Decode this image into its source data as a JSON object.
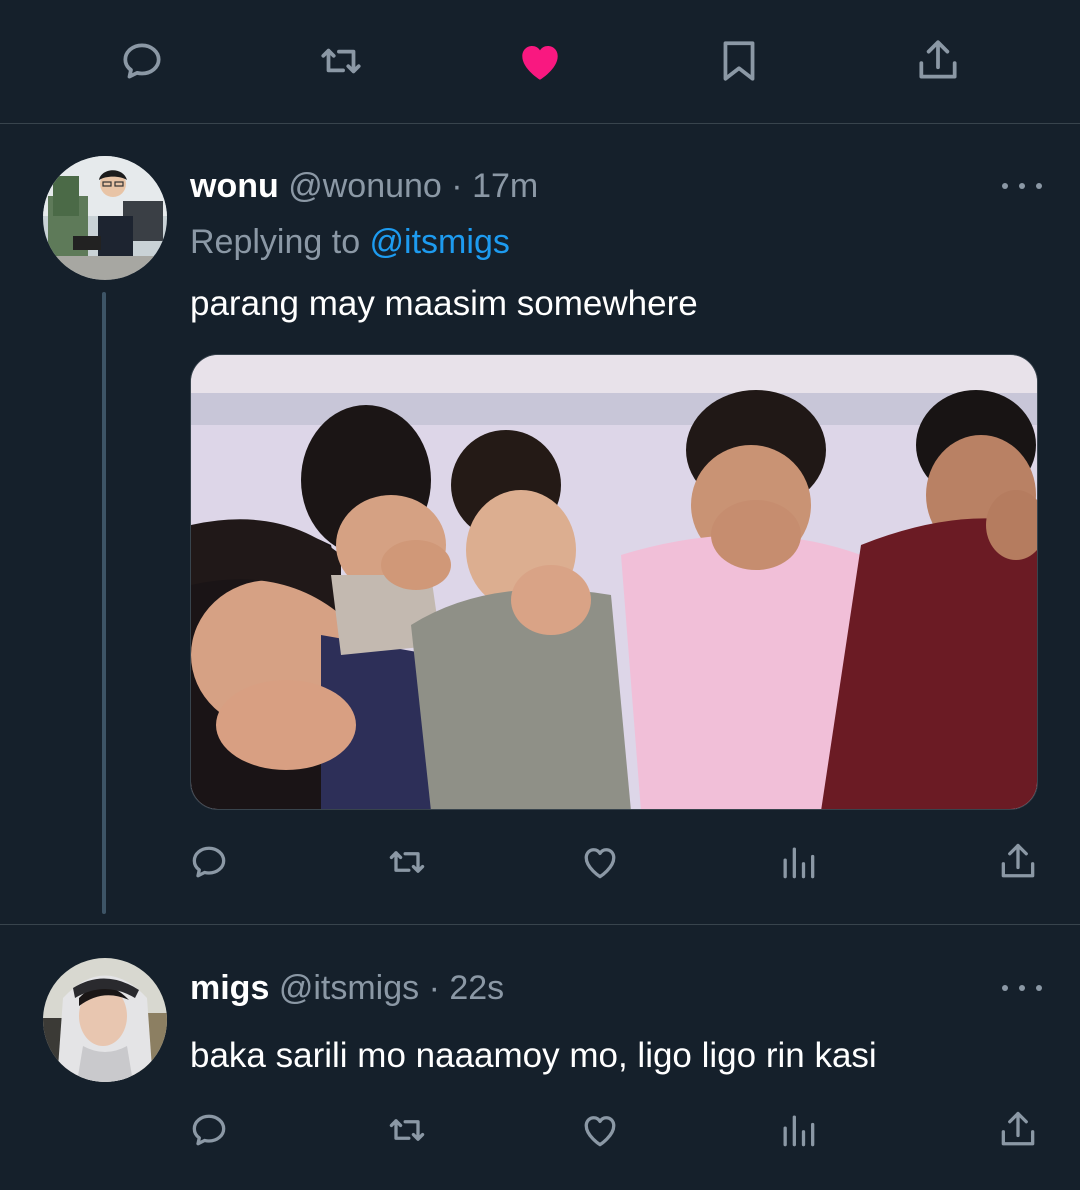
{
  "top_actions": {
    "icons": [
      "reply-icon",
      "retweet-icon",
      "like-icon-filled",
      "bookmark-icon",
      "share-icon"
    ],
    "like_color": "#f91880"
  },
  "tweet1": {
    "display_name": "wonu",
    "handle": "@wonuno",
    "separator": "·",
    "time": "17m",
    "replying_prefix": "Replying to ",
    "replying_to": "@itsmigs",
    "text": "parang may maasim somewhere"
  },
  "tweet2": {
    "display_name": "migs",
    "handle": "@itsmigs",
    "separator": "·",
    "time": "22s",
    "text": "baka sarili mo naaamoy mo, ligo ligo rin kasi"
  },
  "colors": {
    "background": "#15202b",
    "muted_text": "#8b98a5",
    "accent": "#1d9bf0",
    "divider": "#38444d",
    "thread_line": "#3d5466"
  }
}
